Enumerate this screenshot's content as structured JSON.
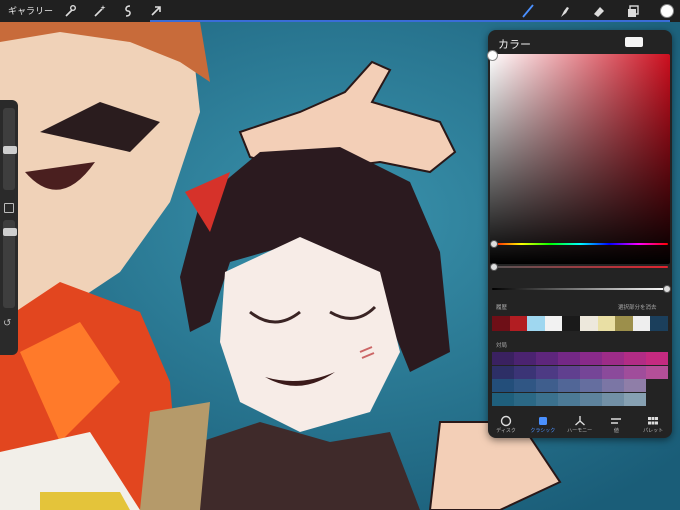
{
  "toolbar": {
    "gallery_label": "ギャラリー",
    "left_tools": [
      "wrench-icon",
      "magic-wand-icon",
      "selection-icon",
      "transform-arrow-icon"
    ],
    "right_tools": [
      "brush-icon",
      "smudge-icon",
      "eraser-icon",
      "layers-icon",
      "color-swatch-icon"
    ],
    "active_color": "#ffffff",
    "accent": "#3a6cd8"
  },
  "sidebar": {
    "tools": [
      "brush-size-slider",
      "modify-button",
      "opacity-slider",
      "undo-icon"
    ],
    "undo_glyph": "↺"
  },
  "color_panel": {
    "title": "カラー",
    "current_color": "#f5f5f5",
    "history_label": "履歴",
    "clear_history_label": "選択部分を消去",
    "history_colors": [
      "#6e0f17",
      "#b21d22",
      "#9fd7f0",
      "#f2f2f2",
      "#1a1a1a",
      "#ede8dc",
      "#e9dfa4",
      "#9c8f4b",
      "#eeeeee",
      "#1b3f5c"
    ],
    "palette_label": "対局",
    "palette_rows": [
      [
        "#3a2160",
        "#4b2370",
        "#5e267c",
        "#742886",
        "#892a8a",
        "#9d2c88",
        "#b22c85",
        "#c52a80"
      ],
      [
        "#2d2f66",
        "#3b3476",
        "#4d3a84",
        "#60408f",
        "#754597",
        "#8b4a9b",
        "#a04d9b",
        "#b44f98"
      ],
      [
        "#234e7a",
        "#305684",
        "#3f5e8d",
        "#516697",
        "#656e9f",
        "#7b76a5",
        "#8f7ea8"
      ],
      [
        "#1f5f7c",
        "#2b6885",
        "#3b718e",
        "#4c7a96",
        "#5e839d",
        "#7290a6",
        "#86a0b2"
      ]
    ],
    "tabs": [
      {
        "label": "ディスク",
        "icon": "disc-icon"
      },
      {
        "label": "クラシック",
        "icon": "classic-square-icon",
        "active": true
      },
      {
        "label": "ハーモニー",
        "icon": "harmony-icon"
      },
      {
        "label": "値",
        "icon": "value-sliders-icon"
      },
      {
        "label": "パレット",
        "icon": "palette-grid-icon"
      }
    ]
  }
}
